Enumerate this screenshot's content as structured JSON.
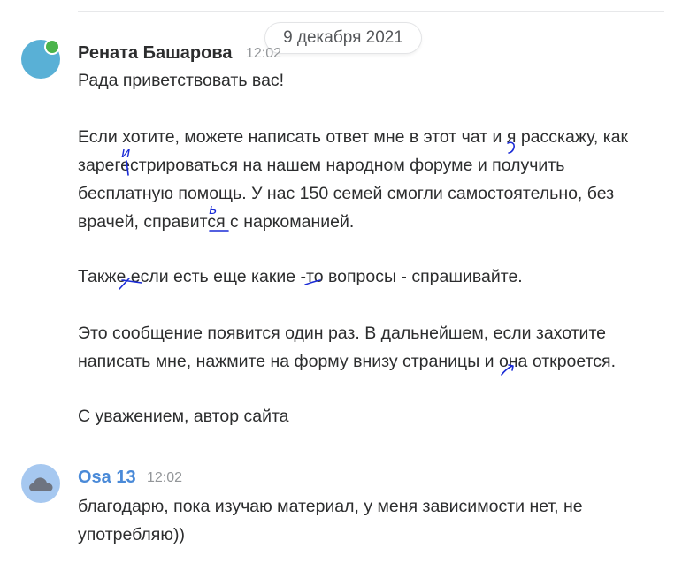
{
  "date_separator": "9 декабря 2021",
  "messages": [
    {
      "author": "Рената Башарова",
      "time": "12:02",
      "lines": [
        "Рада приветствовать вас!",
        "Если хотите, можете написать ответ мне в этот чат и я расскажу, как",
        "зарегестрироваться на нашем народном форуме и получить",
        "бесплатную помощь. У нас 150 семей смогли самостоятельно, без",
        "врачей, справится с наркоманией.",
        "Также если есть еще какие -то вопросы - спрашивайте.",
        "Это сообщение появится один раз. В дальнейшем, если захотите",
        "написать мне, нажмите на форму внизу страницы и она откроется.",
        "С уважением, автор сайта"
      ]
    },
    {
      "author": "Osa 13",
      "time": "12:02",
      "lines": [
        "благодарю, пока изучаю материал, у меня зависимости нет, не",
        "употребляю))"
      ]
    }
  ],
  "annotations": {
    "correction_1": "и",
    "correction_2": "ь"
  },
  "colors": {
    "online": "#4bb34b",
    "link_author": "#4a8ad8",
    "annotation_ink": "#1a2bd6"
  },
  "icons": {
    "avatar_2": "cloud-icon"
  }
}
